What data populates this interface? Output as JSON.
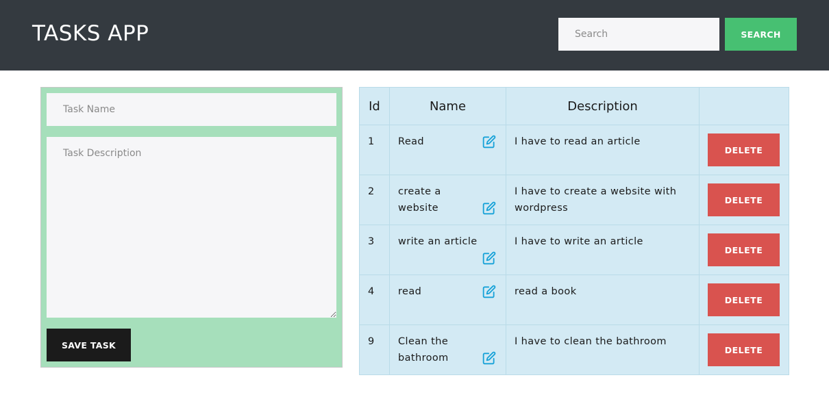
{
  "header": {
    "title": "TASKS APP",
    "search_placeholder": "Search",
    "search_label": "SEARCH"
  },
  "form": {
    "name_placeholder": "Task Name",
    "description_placeholder": "Task Description",
    "save_label": "SAVE TASK"
  },
  "table": {
    "headers": [
      "Id",
      "Name",
      "Description",
      ""
    ],
    "rows": [
      {
        "id": "1",
        "name": "Read",
        "description": "I have to read an article",
        "action": "DELETE",
        "icon": "edit-icon"
      },
      {
        "id": "2",
        "name": "create a website",
        "description": "I have to create a website with wordpress",
        "action": "DELETE",
        "icon": "edit-icon"
      },
      {
        "id": "3",
        "name": "write an article",
        "description": "I have to write an article",
        "action": "DELETE",
        "icon": "edit-icon"
      },
      {
        "id": "4",
        "name": "read",
        "description": "read a book",
        "action": "DELETE",
        "icon": "edit-icon"
      },
      {
        "id": "9",
        "name": "Clean the bathroom",
        "description": "I have to clean the bathroom",
        "action": "DELETE",
        "icon": "edit-icon"
      }
    ]
  },
  "colors": {
    "navbar": "#343a40",
    "search_button": "#47c072",
    "form_panel": "#a6dfbb",
    "table_bg": "#d3eaf4",
    "delete_button": "#d9534f",
    "edit_icon": "#17a2d8"
  }
}
